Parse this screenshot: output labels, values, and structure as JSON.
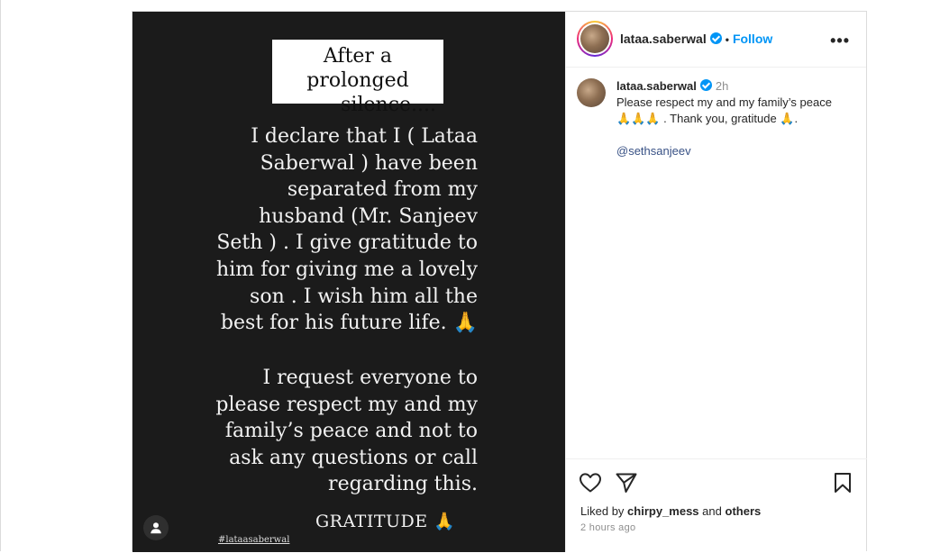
{
  "story": {
    "title_line1": "After a prolonged",
    "title_line2": "silence....",
    "paragraph1": "I declare that I ( Lataa\nSaberwal ) have been\nseparated from my\nhusband (Mr. Sanjeev\nSeth ) . I give gratitude to\nhim for giving me a lovely\nson .  I wish him all the\nbest for his future life. 🙏",
    "paragraph2": "I request everyone to\nplease  respect my and my\nfamily’s peace and not to\nask any questions or call\nregarding this.",
    "closing": "GRATITUDE 🙏",
    "hashtag": "#lataasaberwal"
  },
  "header": {
    "username": "lataa.saberwal",
    "separator": "•",
    "follow_label": "Follow",
    "more_label": "•••"
  },
  "caption": {
    "username": "lataa.saberwal",
    "time": "2h",
    "text_line1": "Please respect my and my family’s peace",
    "text_line2": "🙏🙏🙏 . Thank you, gratitude 🙏.",
    "mention": "@sethsanjeev"
  },
  "engagement": {
    "liked_by_prefix": "Liked by",
    "liked_by_user": "chirpy_mess",
    "liked_by_and": "and",
    "liked_by_others": "others",
    "time_ago": "2 hours ago"
  },
  "icons": {
    "like": "heart-icon",
    "share": "send-icon",
    "save": "bookmark-icon",
    "user": "user-icon"
  }
}
